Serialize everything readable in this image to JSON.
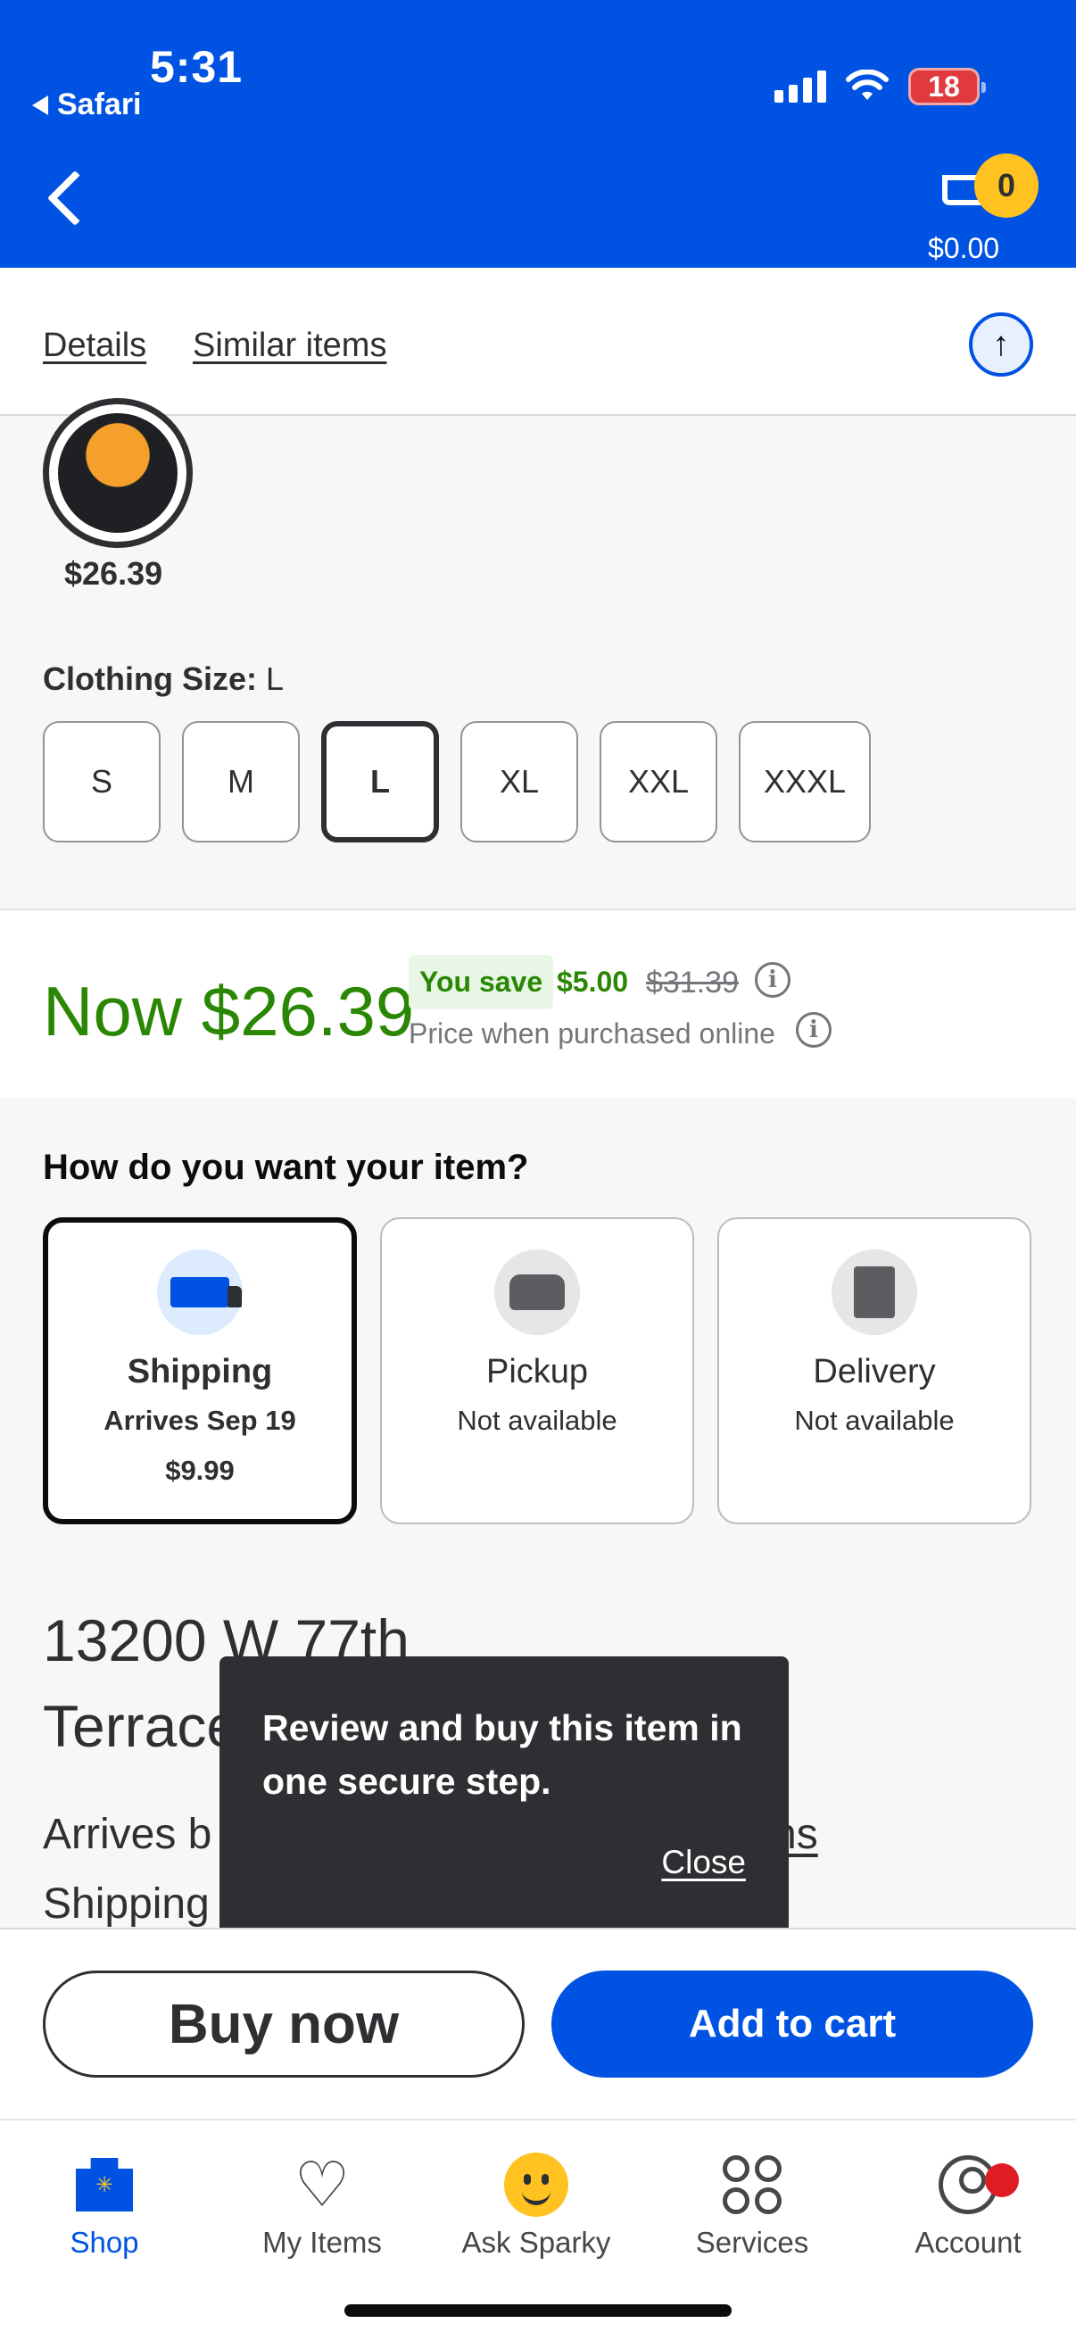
{
  "status_bar": {
    "time": "5:31",
    "back_app": "Safari",
    "battery": "18"
  },
  "header": {
    "cart_count": "0",
    "cart_total": "$0.00"
  },
  "tabs": {
    "details": "Details",
    "similar": "Similar items"
  },
  "variant": {
    "swatch_price": "$26.39",
    "size_label": "Clothing Size:",
    "size_value": "L",
    "sizes": [
      "S",
      "M",
      "L",
      "XL",
      "XXL",
      "XXXL"
    ],
    "selected_size": "L"
  },
  "price": {
    "now": "Now $26.39",
    "you_save": "You save",
    "save_amount": "$5.00",
    "was": "$31.39",
    "note": "Price when purchased online"
  },
  "fulfillment": {
    "title": "How do you want your item?",
    "options": [
      {
        "name": "Shipping",
        "sub": "Arrives Sep 19",
        "cost": "$9.99",
        "selected": true
      },
      {
        "name": "Pickup",
        "sub": "Not available"
      },
      {
        "name": "Delivery",
        "sub": "Not available"
      }
    ],
    "address_line1": "13200 W 77th",
    "address_line2": "Terrace",
    "arrives_partial": "Arrives b",
    "arrives_link_partial": "ns",
    "shipping_partial": "Shipping"
  },
  "tooltip": {
    "text": "Review and buy this item in one secure step.",
    "close": "Close"
  },
  "actions": {
    "buy_now": "Buy now",
    "add_to_cart": "Add to cart"
  },
  "bottom_nav": {
    "shop": "Shop",
    "my_items": "My Items",
    "ask_sparky": "Ask Sparky",
    "services": "Services",
    "account": "Account"
  },
  "colors": {
    "brand_blue": "#0053e2",
    "price_green": "#2a8703",
    "spark_yellow": "#ffc220",
    "alert_red": "#de1c24"
  }
}
